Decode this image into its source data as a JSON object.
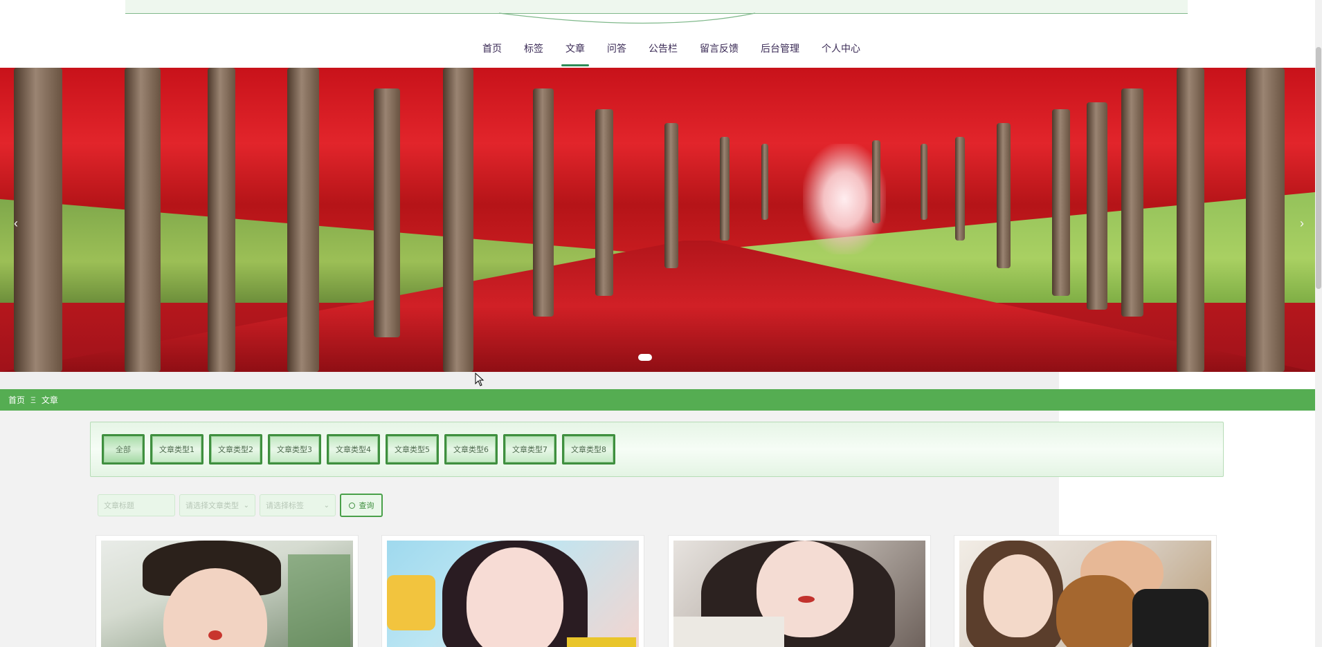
{
  "nav": {
    "items": [
      {
        "label": "首页",
        "active": false
      },
      {
        "label": "标签",
        "active": false
      },
      {
        "label": "文章",
        "active": true
      },
      {
        "label": "问答",
        "active": false
      },
      {
        "label": "公告栏",
        "active": false
      },
      {
        "label": "留言反馈",
        "active": false
      },
      {
        "label": "后台管理",
        "active": false
      },
      {
        "label": "个人中心",
        "active": false
      }
    ]
  },
  "banner": {
    "prev_icon": "chevron-left-icon",
    "next_icon": "chevron-right-icon",
    "prev_glyph": "‹",
    "next_glyph": "›",
    "slide_count": 1,
    "active_slide": 1
  },
  "breadcrumb": {
    "home": "首页",
    "separator": "Ξ",
    "current": "文章",
    "bar_color": "#55ad52"
  },
  "categories": {
    "items": [
      "全部",
      "文章类型1",
      "文章类型2",
      "文章类型3",
      "文章类型4",
      "文章类型5",
      "文章类型6",
      "文章类型7",
      "文章类型8"
    ],
    "active_index": 0
  },
  "search": {
    "title_placeholder": "文章标题",
    "type_placeholder": "请选择文章类型",
    "tag_placeholder": "请选择标签",
    "button_label": "查询",
    "button_icon": "search-icon"
  },
  "cards": [
    {
      "image": "portrait-young-man"
    },
    {
      "image": "portrait-woman-long-hair"
    },
    {
      "image": "portrait-woman-closeup"
    },
    {
      "image": "couple-with-dog"
    }
  ],
  "colors": {
    "accent_green": "#55ad52",
    "nav_text": "#3a2a55",
    "active_underline": "#2e8b57"
  }
}
